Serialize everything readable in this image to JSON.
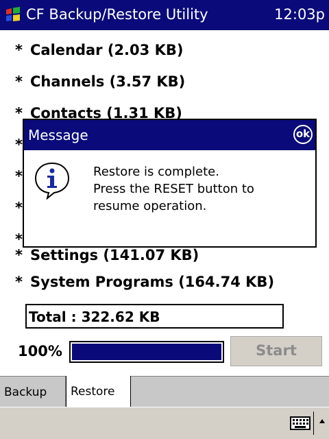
{
  "titlebar": {
    "title": "CF Backup/Restore Utility",
    "clock": "12:03p",
    "icon": "windows-flag-icon"
  },
  "items": [
    {
      "star": "*",
      "label": "Calendar (2.03 KB)"
    },
    {
      "star": "*",
      "label": "Channels (3.57 KB)"
    },
    {
      "star": "*",
      "label": "Contacts (1.31 KB)"
    },
    {
      "star": "*",
      "label": ""
    },
    {
      "star": "*",
      "label": ""
    },
    {
      "star": "*",
      "label": ""
    },
    {
      "star": "*",
      "label": ""
    },
    {
      "star": "*",
      "label": "Settings (141.07 KB)"
    },
    {
      "star": "*",
      "label": "System Programs (164.74 KB)"
    }
  ],
  "dialog": {
    "title": "Message",
    "ok_label": "ok",
    "icon": "info-icon",
    "lines": [
      "Restore is complete.",
      "Press the RESET button to",
      "resume operation."
    ]
  },
  "total": {
    "label": "Total :  322.62 KB"
  },
  "progress": {
    "percent_label": "100%",
    "value": 1.0
  },
  "start_button": {
    "label": "Start",
    "enabled": false
  },
  "tabs": [
    {
      "label": "Backup",
      "active": false
    },
    {
      "label": "Restore",
      "active": true
    }
  ],
  "menubar": {
    "keyboard_icon": "keyboard-icon",
    "arrow_icon": "up-arrow-icon"
  },
  "colors": {
    "titlebar": "#0a0a7a",
    "progress_fill": "#0a0a7a",
    "disabled_text": "#8c8c8c"
  }
}
